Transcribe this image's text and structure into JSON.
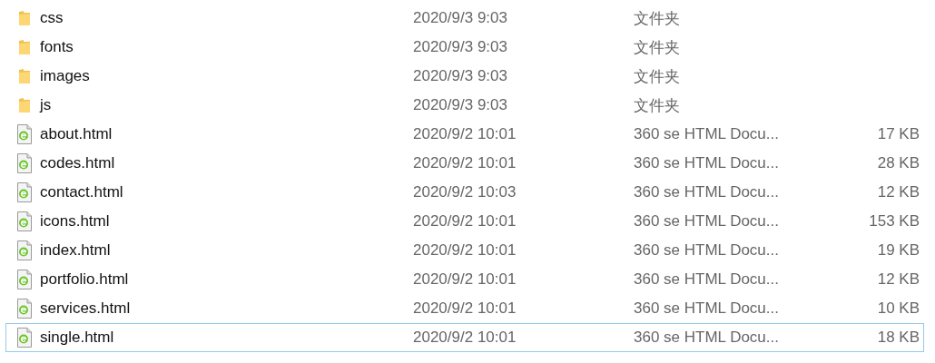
{
  "files": [
    {
      "kind": "folder",
      "name": "css",
      "date": "2020/9/3 9:03",
      "type": "文件夹",
      "focused": false
    },
    {
      "kind": "folder",
      "name": "fonts",
      "date": "2020/9/3 9:03",
      "type": "文件夹",
      "focused": false
    },
    {
      "kind": "folder",
      "name": "images",
      "date": "2020/9/3 9:03",
      "type": "文件夹",
      "focused": false
    },
    {
      "kind": "folder",
      "name": "js",
      "date": "2020/9/3 9:03",
      "type": "文件夹",
      "focused": false
    },
    {
      "kind": "html",
      "name": "about.html",
      "date": "2020/9/2 10:01",
      "type": "360 se HTML Docu...",
      "size": "17 KB",
      "focused": false
    },
    {
      "kind": "html",
      "name": "codes.html",
      "date": "2020/9/2 10:01",
      "type": "360 se HTML Docu...",
      "size": "28 KB",
      "focused": false
    },
    {
      "kind": "html",
      "name": "contact.html",
      "date": "2020/9/2 10:03",
      "type": "360 se HTML Docu...",
      "size": "12 KB",
      "focused": false
    },
    {
      "kind": "html",
      "name": "icons.html",
      "date": "2020/9/2 10:01",
      "type": "360 se HTML Docu...",
      "size": "153 KB",
      "focused": false
    },
    {
      "kind": "html",
      "name": "index.html",
      "date": "2020/9/2 10:01",
      "type": "360 se HTML Docu...",
      "size": "19 KB",
      "focused": false
    },
    {
      "kind": "html",
      "name": "portfolio.html",
      "date": "2020/9/2 10:01",
      "type": "360 se HTML Docu...",
      "size": "12 KB",
      "focused": false
    },
    {
      "kind": "html",
      "name": "services.html",
      "date": "2020/9/2 10:01",
      "type": "360 se HTML Docu...",
      "size": "10 KB",
      "focused": false
    },
    {
      "kind": "html",
      "name": "single.html",
      "date": "2020/9/2 10:01",
      "type": "360 se HTML Docu...",
      "size": "18 KB",
      "focused": true
    }
  ]
}
